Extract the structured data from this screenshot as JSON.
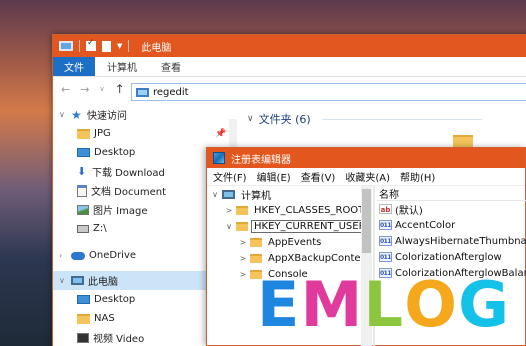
{
  "explorer": {
    "title": "此电脑",
    "ribbon_tabs": [
      "文件",
      "计算机",
      "查看"
    ],
    "address": "regedit",
    "nav_items": [
      {
        "label": "快速访问",
        "icon": "star-icon"
      },
      {
        "label": "JPG",
        "icon": "folder-icon"
      },
      {
        "label": "Desktop",
        "icon": "desktop-icon"
      },
      {
        "label": "下载 Download",
        "icon": "download-icon"
      },
      {
        "label": "文档 Document",
        "icon": "document-icon"
      },
      {
        "label": "图片 Image",
        "icon": "picture-icon"
      },
      {
        "label": "Z:\\",
        "icon": "drive-icon"
      },
      {
        "label": "OneDrive",
        "icon": "cloud-icon"
      },
      {
        "label": "此电脑",
        "icon": "computer-icon"
      },
      {
        "label": "Desktop",
        "icon": "desktop-icon"
      },
      {
        "label": "NAS",
        "icon": "folder-icon"
      },
      {
        "label": "视频 Video",
        "icon": "video-icon"
      }
    ],
    "content_group": "文件夹 (6)"
  },
  "regedit": {
    "title": "注册表编辑器",
    "menu": [
      "文件(F)",
      "编辑(E)",
      "查看(V)",
      "收藏夹(A)",
      "帮助(H)"
    ],
    "tree": [
      {
        "label": "计算机",
        "level": 0,
        "expander": "∨"
      },
      {
        "label": "HKEY_CLASSES_ROOT",
        "level": 1,
        "expander": ">"
      },
      {
        "label": "HKEY_CURRENT_USER",
        "level": 1,
        "expander": "∨"
      },
      {
        "label": "AppEvents",
        "level": 2,
        "expander": ">"
      },
      {
        "label": "AppXBackupConter",
        "level": 2,
        "expander": ">"
      },
      {
        "label": "Console",
        "level": 2,
        "expander": ">"
      }
    ],
    "values_header": "名称",
    "values": [
      {
        "name": "(默认)",
        "type": "string"
      },
      {
        "name": "AccentColor",
        "type": "binary"
      },
      {
        "name": "AlwaysHibernateThumbnails",
        "type": "binary"
      },
      {
        "name": "ColorizationAfterglow",
        "type": "binary"
      },
      {
        "name": "ColorizationAfterglowBalance",
        "type": "binary"
      }
    ]
  },
  "watermark": {
    "letters": [
      "E",
      "M",
      "L",
      "O",
      "G"
    ],
    "colors": [
      "#1f86e0",
      "#e03a9d",
      "#8cc63f",
      "#f6a81c",
      "#14c1e8"
    ]
  }
}
